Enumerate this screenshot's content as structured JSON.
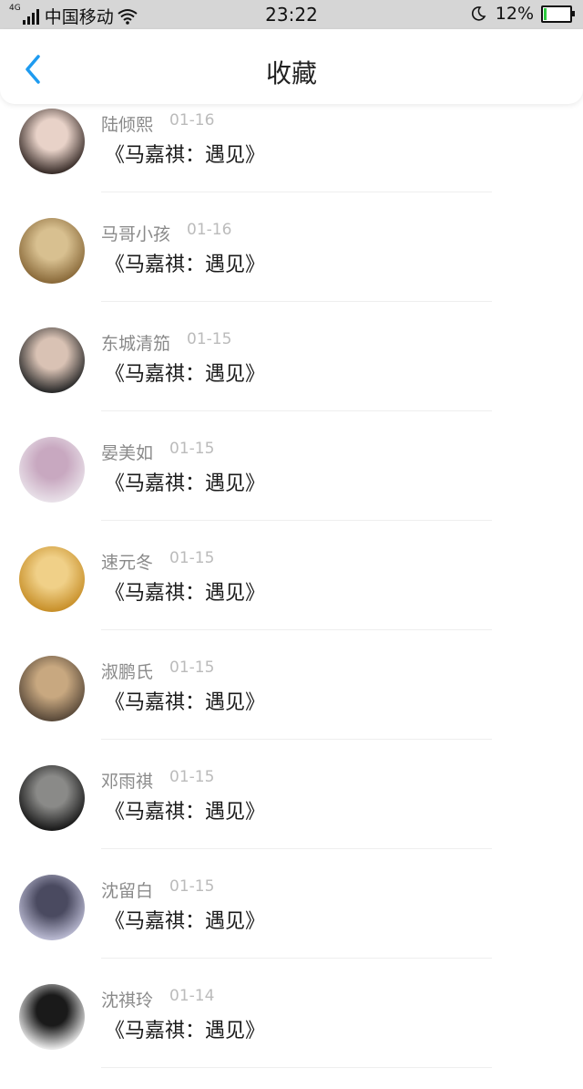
{
  "status_bar": {
    "network": "4G",
    "carrier": "中国移动",
    "time": "23:22",
    "battery": "12%",
    "battery_level": 0.12
  },
  "header": {
    "title": "收藏"
  },
  "items": [
    {
      "name": "陆倾熙",
      "date": "01-16",
      "title": "《马嘉祺：遇见》",
      "avatar_colors": [
        "#3a2e2a",
        "#e8d2c8"
      ]
    },
    {
      "name": "马哥小孩",
      "date": "01-16",
      "title": "《马嘉祺：遇见》",
      "avatar_colors": [
        "#8a6a3a",
        "#d8c090"
      ]
    },
    {
      "name": "东城清笳",
      "date": "01-15",
      "title": "《马嘉祺：遇见》",
      "avatar_colors": [
        "#2a2a2a",
        "#d9c2b4"
      ]
    },
    {
      "name": "晏美如",
      "date": "01-15",
      "title": "《马嘉祺：遇见》",
      "avatar_colors": [
        "#e8e0e8",
        "#c8a8c0"
      ]
    },
    {
      "name": "速元冬",
      "date": "01-15",
      "title": "《马嘉祺：遇见》",
      "avatar_colors": [
        "#c8902a",
        "#f0d088"
      ]
    },
    {
      "name": "淑鹏氏",
      "date": "01-15",
      "title": "《马嘉祺：遇见》",
      "avatar_colors": [
        "#5a4a3a",
        "#c8a880"
      ]
    },
    {
      "name": "邓雨祺",
      "date": "01-15",
      "title": "《马嘉祺：遇见》",
      "avatar_colors": [
        "#1a1a1a",
        "#8a8a88"
      ]
    },
    {
      "name": "沈留白",
      "date": "01-15",
      "title": "《马嘉祺：遇见》",
      "avatar_colors": [
        "#b8b8d0",
        "#4a4a60"
      ]
    },
    {
      "name": "沈祺玲",
      "date": "01-14",
      "title": "《马嘉祺：遇见》",
      "avatar_colors": [
        "#e8e8e8",
        "#1a1a1a"
      ]
    }
  ]
}
